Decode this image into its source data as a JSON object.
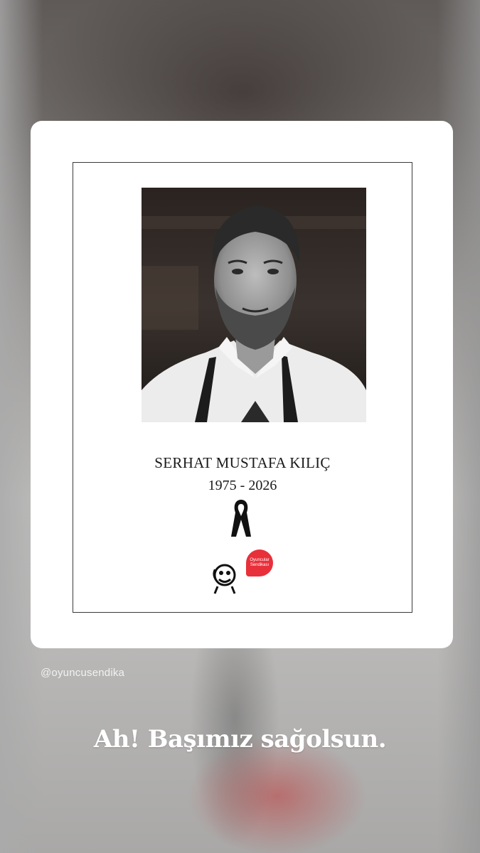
{
  "story": {
    "handle": "@oyuncusendika",
    "caption": "Ah! Başımız sağolsun."
  },
  "post": {
    "name": "SERHAT MUSTAFA KILIÇ",
    "years": "1975 - 2026",
    "photo_icon": "portrait-photo",
    "ribbon_icon": "mourning-ribbon-icon",
    "logos": {
      "left_icon": "theatre-mask-logo",
      "right_label_line1": "Oyuncular",
      "right_label_line2": "Sendikası",
      "right_color": "#e8303a"
    }
  }
}
